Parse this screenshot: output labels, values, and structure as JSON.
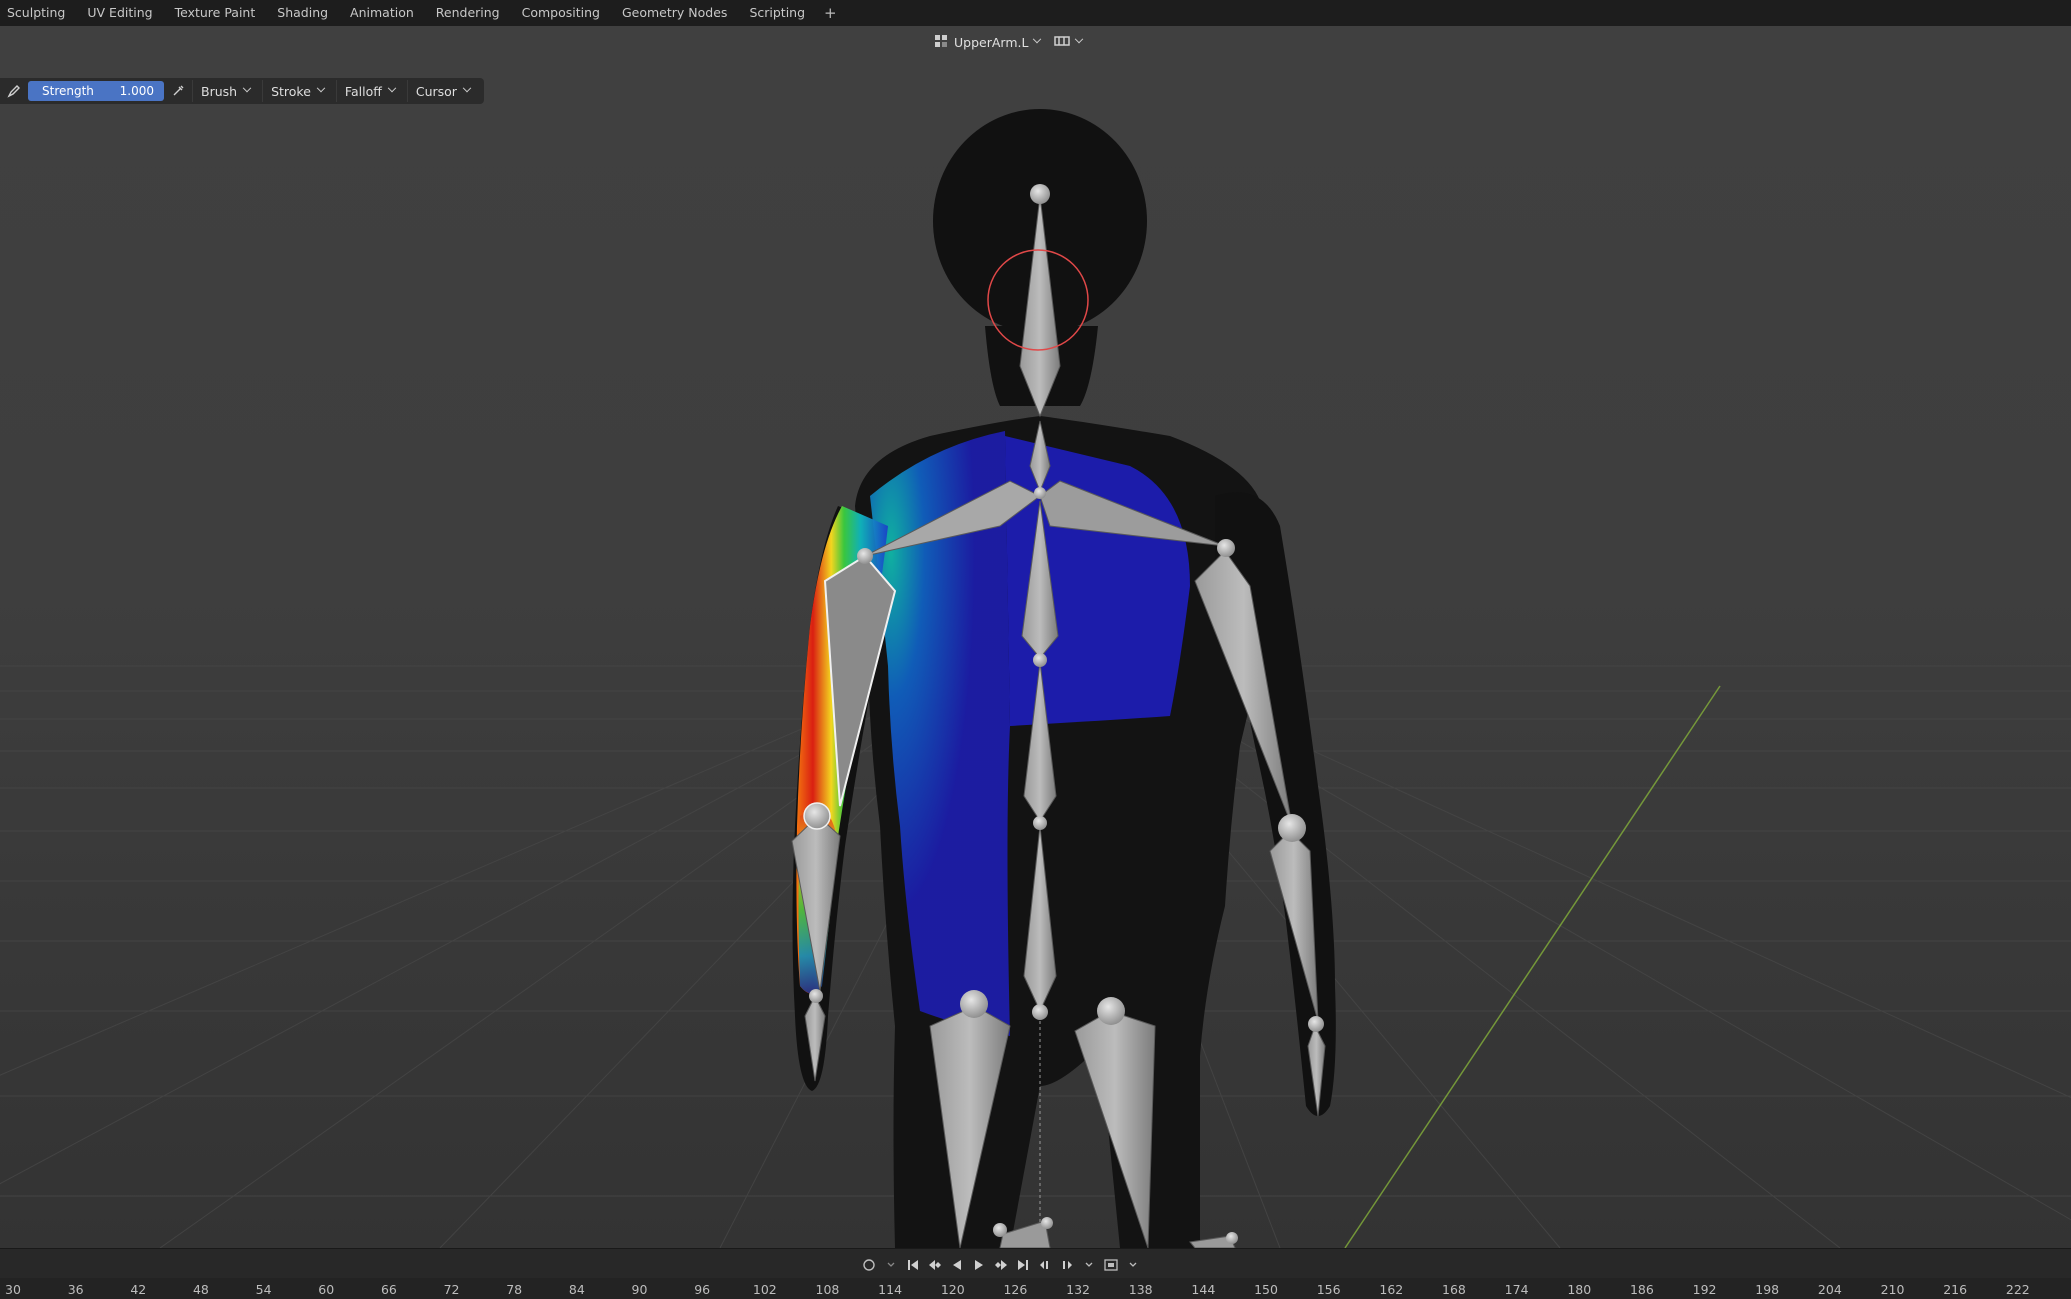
{
  "workspace_tabs": [
    "Sculpting",
    "UV Editing",
    "Texture Paint",
    "Shading",
    "Animation",
    "Rendering",
    "Compositing",
    "Geometry Nodes",
    "Scripting"
  ],
  "add_tab_label": "+",
  "viewport": {
    "active_bone": "UpperArm.L"
  },
  "toolbar": {
    "strength_label": "Strength",
    "strength_value": "1.000",
    "brush_label": "Brush",
    "stroke_label": "Stroke",
    "falloff_label": "Falloff",
    "cursor_label": "Cursor"
  },
  "timeline": {
    "frame_ticks": [
      "30",
      "36",
      "42",
      "48",
      "54",
      "60",
      "66",
      "72",
      "78",
      "84",
      "90",
      "96",
      "102",
      "108",
      "114",
      "120",
      "126",
      "132",
      "138",
      "144",
      "150",
      "156",
      "162",
      "168",
      "174",
      "180",
      "186",
      "192",
      "198",
      "204",
      "210",
      "216",
      "222"
    ]
  },
  "icons": {
    "object": "armature-data-icon",
    "brush": "brush-icon",
    "eyedropper": "eyedropper-icon",
    "playback": [
      "jump-start-icon",
      "prev-keyframe-icon",
      "play-reverse-icon",
      "play-icon",
      "next-keyframe-icon",
      "jump-end-icon"
    ]
  },
  "colors": {
    "accent": "#4a74c4",
    "brush_circle": "#e04848",
    "y_axis": "#7fa83a",
    "weight_high": "#e02818",
    "weight_low": "#1c1ca8"
  }
}
